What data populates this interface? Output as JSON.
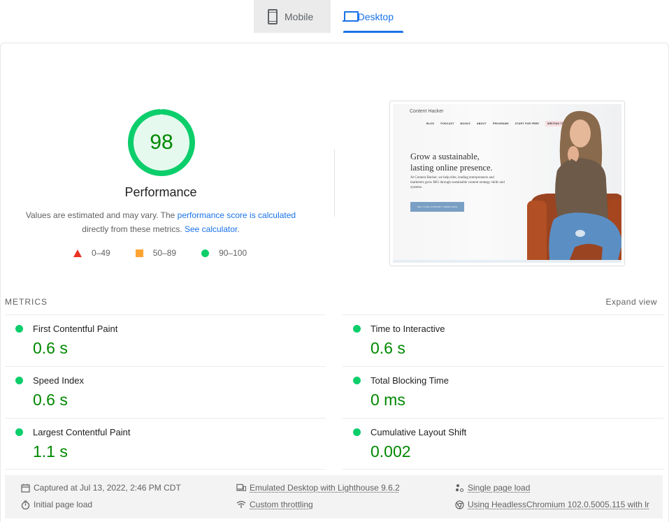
{
  "tabs": [
    {
      "label": "Mobile",
      "icon": "mobile-icon",
      "active": false
    },
    {
      "label": "Desktop",
      "icon": "desktop-icon",
      "active": true
    }
  ],
  "score": {
    "value": "98",
    "fraction": 0.98,
    "category": "Performance",
    "color": "#0cce6b",
    "text_color": "#008800",
    "desc_prefix": "Values are estimated and may vary. The ",
    "desc_link1": "performance score is calculated",
    "desc_middle": " directly from these metrics. ",
    "desc_link2": "See calculator",
    "desc_suffix": "."
  },
  "legend": [
    {
      "shape": "triangle",
      "range": "0–49",
      "color": "#eb3223"
    },
    {
      "shape": "square",
      "range": "50–89",
      "color": "#ffa433"
    },
    {
      "shape": "circle",
      "range": "90–100",
      "color": "#0cce6b"
    }
  ],
  "thumbnail": {
    "logo": "Content Hacker",
    "nav": [
      "BLOG",
      "PODCAST",
      "BOOKS",
      "ABOUT",
      "PROGRAMS",
      "START FOR FREE",
      "WRITING TEMPLATE SALE"
    ],
    "headline_line1": "Grow a sustainable,",
    "headline_line2": "lasting online presence.",
    "paragraph": "At Content Hacker, we help elite, leading entrepreneurs and marketers grow BIG through sustainable content strategy skills and systems.",
    "cta": "GET YOUR CONTENT TEMPLATES"
  },
  "metrics": {
    "header": "METRICS",
    "expand": "Expand view",
    "left": [
      {
        "name": "First Contentful Paint",
        "value": "0.6 s"
      },
      {
        "name": "Speed Index",
        "value": "0.6 s"
      },
      {
        "name": "Largest Contentful Paint",
        "value": "1.1 s"
      }
    ],
    "right": [
      {
        "name": "Time to Interactive",
        "value": "0.6 s"
      },
      {
        "name": "Total Blocking Time",
        "value": "0 ms"
      },
      {
        "name": "Cumulative Layout Shift",
        "value": "0.002"
      }
    ]
  },
  "info": {
    "captured": "Captured at Jul 13, 2022, 2:46 PM CDT",
    "initial": "Initial page load",
    "emulated": "Emulated Desktop with Lighthouse 9.6.2",
    "throttling": "Custom throttling",
    "single": "Single page load",
    "browser": "Using HeadlessChromium 102.0.5005.115 with lr"
  }
}
